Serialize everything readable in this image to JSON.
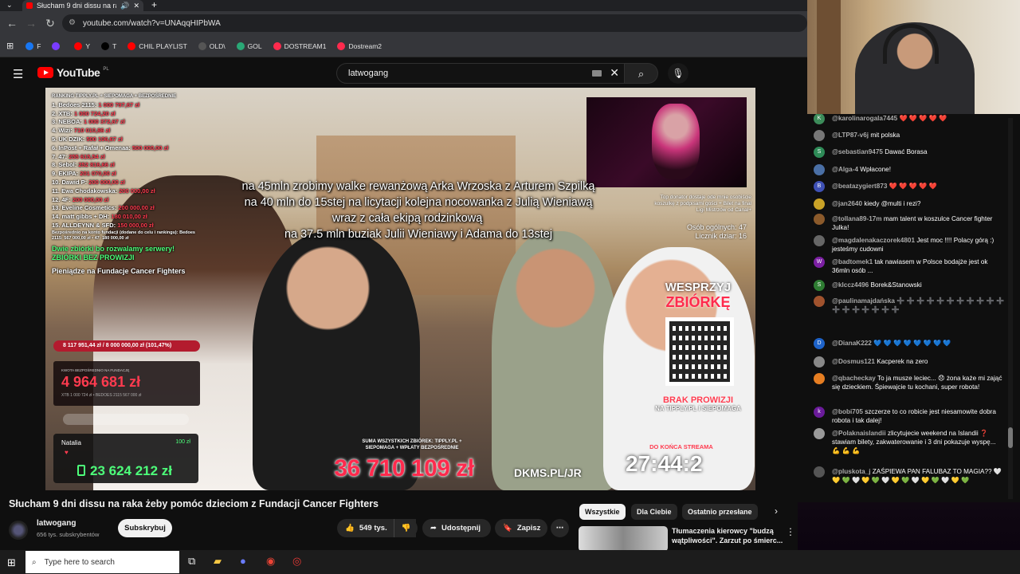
{
  "browser": {
    "tab_title": "Słucham 9 dni dissu na raka",
    "url": "youtube.com/watch?v=UNAqqHIPbWA",
    "bookmarks": [
      {
        "label": "F",
        "color": "#1877f2"
      },
      {
        "label": "",
        "color": "#7a3cff"
      },
      {
        "label": "Y",
        "color": "#ff0000"
      },
      {
        "label": "T",
        "color": "#000000"
      },
      {
        "label": "CHIL PLAYLIST",
        "color": "#ff0000"
      },
      {
        "label": "OLD\\",
        "color": "#555555"
      },
      {
        "label": "GOL",
        "color": "#2aa876"
      },
      {
        "label": "DOSTREAM1",
        "color": "#ff2a4d"
      },
      {
        "label": "Dostream2",
        "color": "#ff2a4d"
      }
    ]
  },
  "youtube": {
    "logo_text": "YouTube",
    "region": "PL",
    "search_value": "latwogang"
  },
  "video": {
    "ranking_header": "RANKING TIPPLY.PL + SIEPOMAGA + BEZPOŚREDNIE",
    "ranking": [
      {
        "label": "1. Bedoes 2115:",
        "value": "1 000 797,67 zł"
      },
      {
        "label": "2. XTB:",
        "value": "1 000 724,20 zł"
      },
      {
        "label": "3. NEBOA:",
        "value": "1 000 372,67 zł"
      },
      {
        "label": "4. Wizi:",
        "value": "710 010,86 zł"
      },
      {
        "label": "5. UK DZIK:",
        "value": "500 106,67 zł"
      },
      {
        "label": "6. InPost + Rafał + Omenaa:",
        "value": "500 000,00 zł"
      },
      {
        "label": "7. 47:",
        "value": "255 615,54 zł"
      },
      {
        "label": "8. Sebol:",
        "value": "252 816,66 zł"
      },
      {
        "label": "9. EKIPA:",
        "value": "201 070,00 zł"
      },
      {
        "label": "10. Dawid P:",
        "value": "200 000,00 zł"
      },
      {
        "label": "11. Ewa Chodakowska:",
        "value": "200 000,00 zł"
      },
      {
        "label": "12. 4F:",
        "value": "200 000,00 zł"
      },
      {
        "label": "13. Eveline Cosmetics:",
        "value": "200 000,00 zł"
      },
      {
        "label": "14. matt gibbs + DH:",
        "value": "180 010,00 zł"
      },
      {
        "label": "15. ALLDEYNN & SFD:",
        "value": "150 000,00 zł"
      }
    ],
    "direct_note": "Bezpośrednio na konto fundacji (dodane do celu i rankingu): Bedoes 2115: 567 000,00 zł • 47: 180 000,00 zł",
    "green_note_1": "Dwie zbiórki bo rozwalamy serwery!",
    "green_note_2": "ZBIÓRKI BEZ PROWIZJI",
    "fund_label": "Pieniądze na Fundacje Cancer Fighters",
    "fund_progress": "8 117 951,44 zł / 8 000 000,00 zł (101,47%)",
    "box_label": "KWOTA BEZPOŚREDNIO NA FUNDACJĘ",
    "box_amount": "4 964 681 zł",
    "box_sub": "XTB 1 000 724 zł • BEDOES 2115 567 000 zł",
    "donor_name": "Natalia",
    "donor_amount": "100 zł",
    "donor_balance": "23 624 212 zł",
    "overlay_lines": [
      "na 45mln zrobimy walke rewanżową  Arka Wrzoska z Arturem Szpilką",
      "na 40 mln do 15stej na licytacji kolejna nocowanka z Julią Wieniawą",
      "wraz z cała ekipą rodzinkową",
      "na 37.5 mln buziak Julii Wieniawy i Adama do 13stej"
    ],
    "pip_caption": "Top donator dostaje ode mnie osobiście koszulkę z podpisami gości + Bilet na final Ligi Mistrzów od Canal+",
    "viewers": "Osób ogólnych: 47",
    "hit_count": "Licznik dziar: 16",
    "support_1": "WESPRZYJ",
    "support_2": "ZBIÓRKĘ",
    "no_fee_1": "BRAK PROWIZJI",
    "no_fee_2": "NA TIPPLY.PL I SIEPOMAGA",
    "total_label": "SUMA WSZYSTKICH ZBIÓREK: TIPPLY.PL + SIEPOMAGA + WPŁATY BEZPOŚREDNIE",
    "total": "36 710 109 zł",
    "dkms": "DKMS.PL/JR",
    "countdown_label": "DO KOŃCA STREAMA",
    "countdown": "27:44:2"
  },
  "details": {
    "title": "Słucham 9 dni dissu na raka żeby pomóc dzieciom z Fundacji Cancer Fighters",
    "channel": "latwogang",
    "subs": "656 tys. subskrybentów",
    "subscribe": "Subskrybuj",
    "likes": "549 tys.",
    "share": "Udostępnij",
    "save": "Zapisz"
  },
  "chips": {
    "all": "Wszystkie",
    "for_you": "Dla Ciebie",
    "recent": "Ostatnio przesłane"
  },
  "recommendation": {
    "title": "Tłumaczenia kierowcy \"budzą wątpliwości\". Zarzut po śmierc..."
  },
  "chat": [
    {
      "user": "@karolinarogala7445",
      "text": "❤️ ❤️ ❤️ ❤️ ❤️",
      "color": "#3c8c5a",
      "initial": "K"
    },
    {
      "user": "@LTP87-v6j",
      "text": "mit polska",
      "color": "#777777",
      "initial": ""
    },
    {
      "user": "@sebastian9475",
      "text": "Dawać Borasa",
      "color": "#2e8b57",
      "initial": "S"
    },
    {
      "user": "@Alga-4",
      "text": "Wpłacone!",
      "color": "#4a6fa5",
      "initial": ""
    },
    {
      "user": "@beatazygiert873",
      "text": "❤️ ❤️ ❤️ ❤️ ❤️",
      "color": "#3f51b5",
      "initial": "B"
    },
    {
      "user": "@jan2640",
      "text": "kiedy @multi i rezi?",
      "color": "#c9a227",
      "initial": ""
    },
    {
      "user": "@tollana89-17m",
      "text": "mam talent w koszulce Cancer fighter Julka!",
      "color": "#8b5a2b",
      "initial": ""
    },
    {
      "user": "@magdalenakaczorek4801",
      "text": "Jest moc !!!! Polacy górą :) jesteśmy cudowni",
      "color": "#666666",
      "initial": ""
    },
    {
      "user": "@badtomek1",
      "text": "tak nawiasem w Polsce bodajże jest ok 36mln osób ...",
      "color": "#7b1fa2",
      "initial": "W"
    },
    {
      "user": "@klccz4496",
      "text": "Borek&Stanowski",
      "color": "#2e7d32",
      "initial": "S"
    },
    {
      "user": "@paulinamajdańska",
      "text": "➕ ➕ ➕ ➕ ➕ ➕ ➕ ➕ ➕ ➕ ➕ ➕ ➕ ➕ ➕ ➕ ➕ ➕",
      "color": "#a0522d",
      "initial": ""
    },
    {
      "user": "@DianaK222",
      "text": "💙 💙 💙 💙 💙 💙 💙 💙",
      "color": "#1e63c9",
      "initial": "D"
    },
    {
      "user": "@Dosmus121",
      "text": "Kacperek na zero",
      "color": "#888888",
      "initial": ""
    },
    {
      "user": "@qbacheckay",
      "text": "To ja musze leciec... 😞 żona każe mi zająć się dzieckiem. Śpiewajcie tu kochani, super robota!",
      "color": "#e67e22",
      "initial": ""
    },
    {
      "user": "@bobi705",
      "text": "szczerze to co robicie jest niesamowite dobra robota i tak dalej!",
      "color": "#6a1b9a",
      "initial": "k"
    },
    {
      "user": "@Polaknaislandii",
      "text": "zlicytujecie weekend na Islandii ❓ stawiam bilety, zakwaterowanie i 3 dni pokazuje wyspę... 💪 💪 💪",
      "color": "#999999",
      "initial": ""
    },
    {
      "user": "@pluskota_j",
      "text": "ZAŚPIEWA PAN FALUBAZ TO MAGIA?? 🤍 💛 💚 🤍 💛 💚 🤍 💛 💚 🤍 💛 💚 🤍 💛 💚",
      "color": "#555555",
      "initial": ""
    }
  ],
  "taskbar": {
    "search_placeholder": "Type here to search"
  }
}
